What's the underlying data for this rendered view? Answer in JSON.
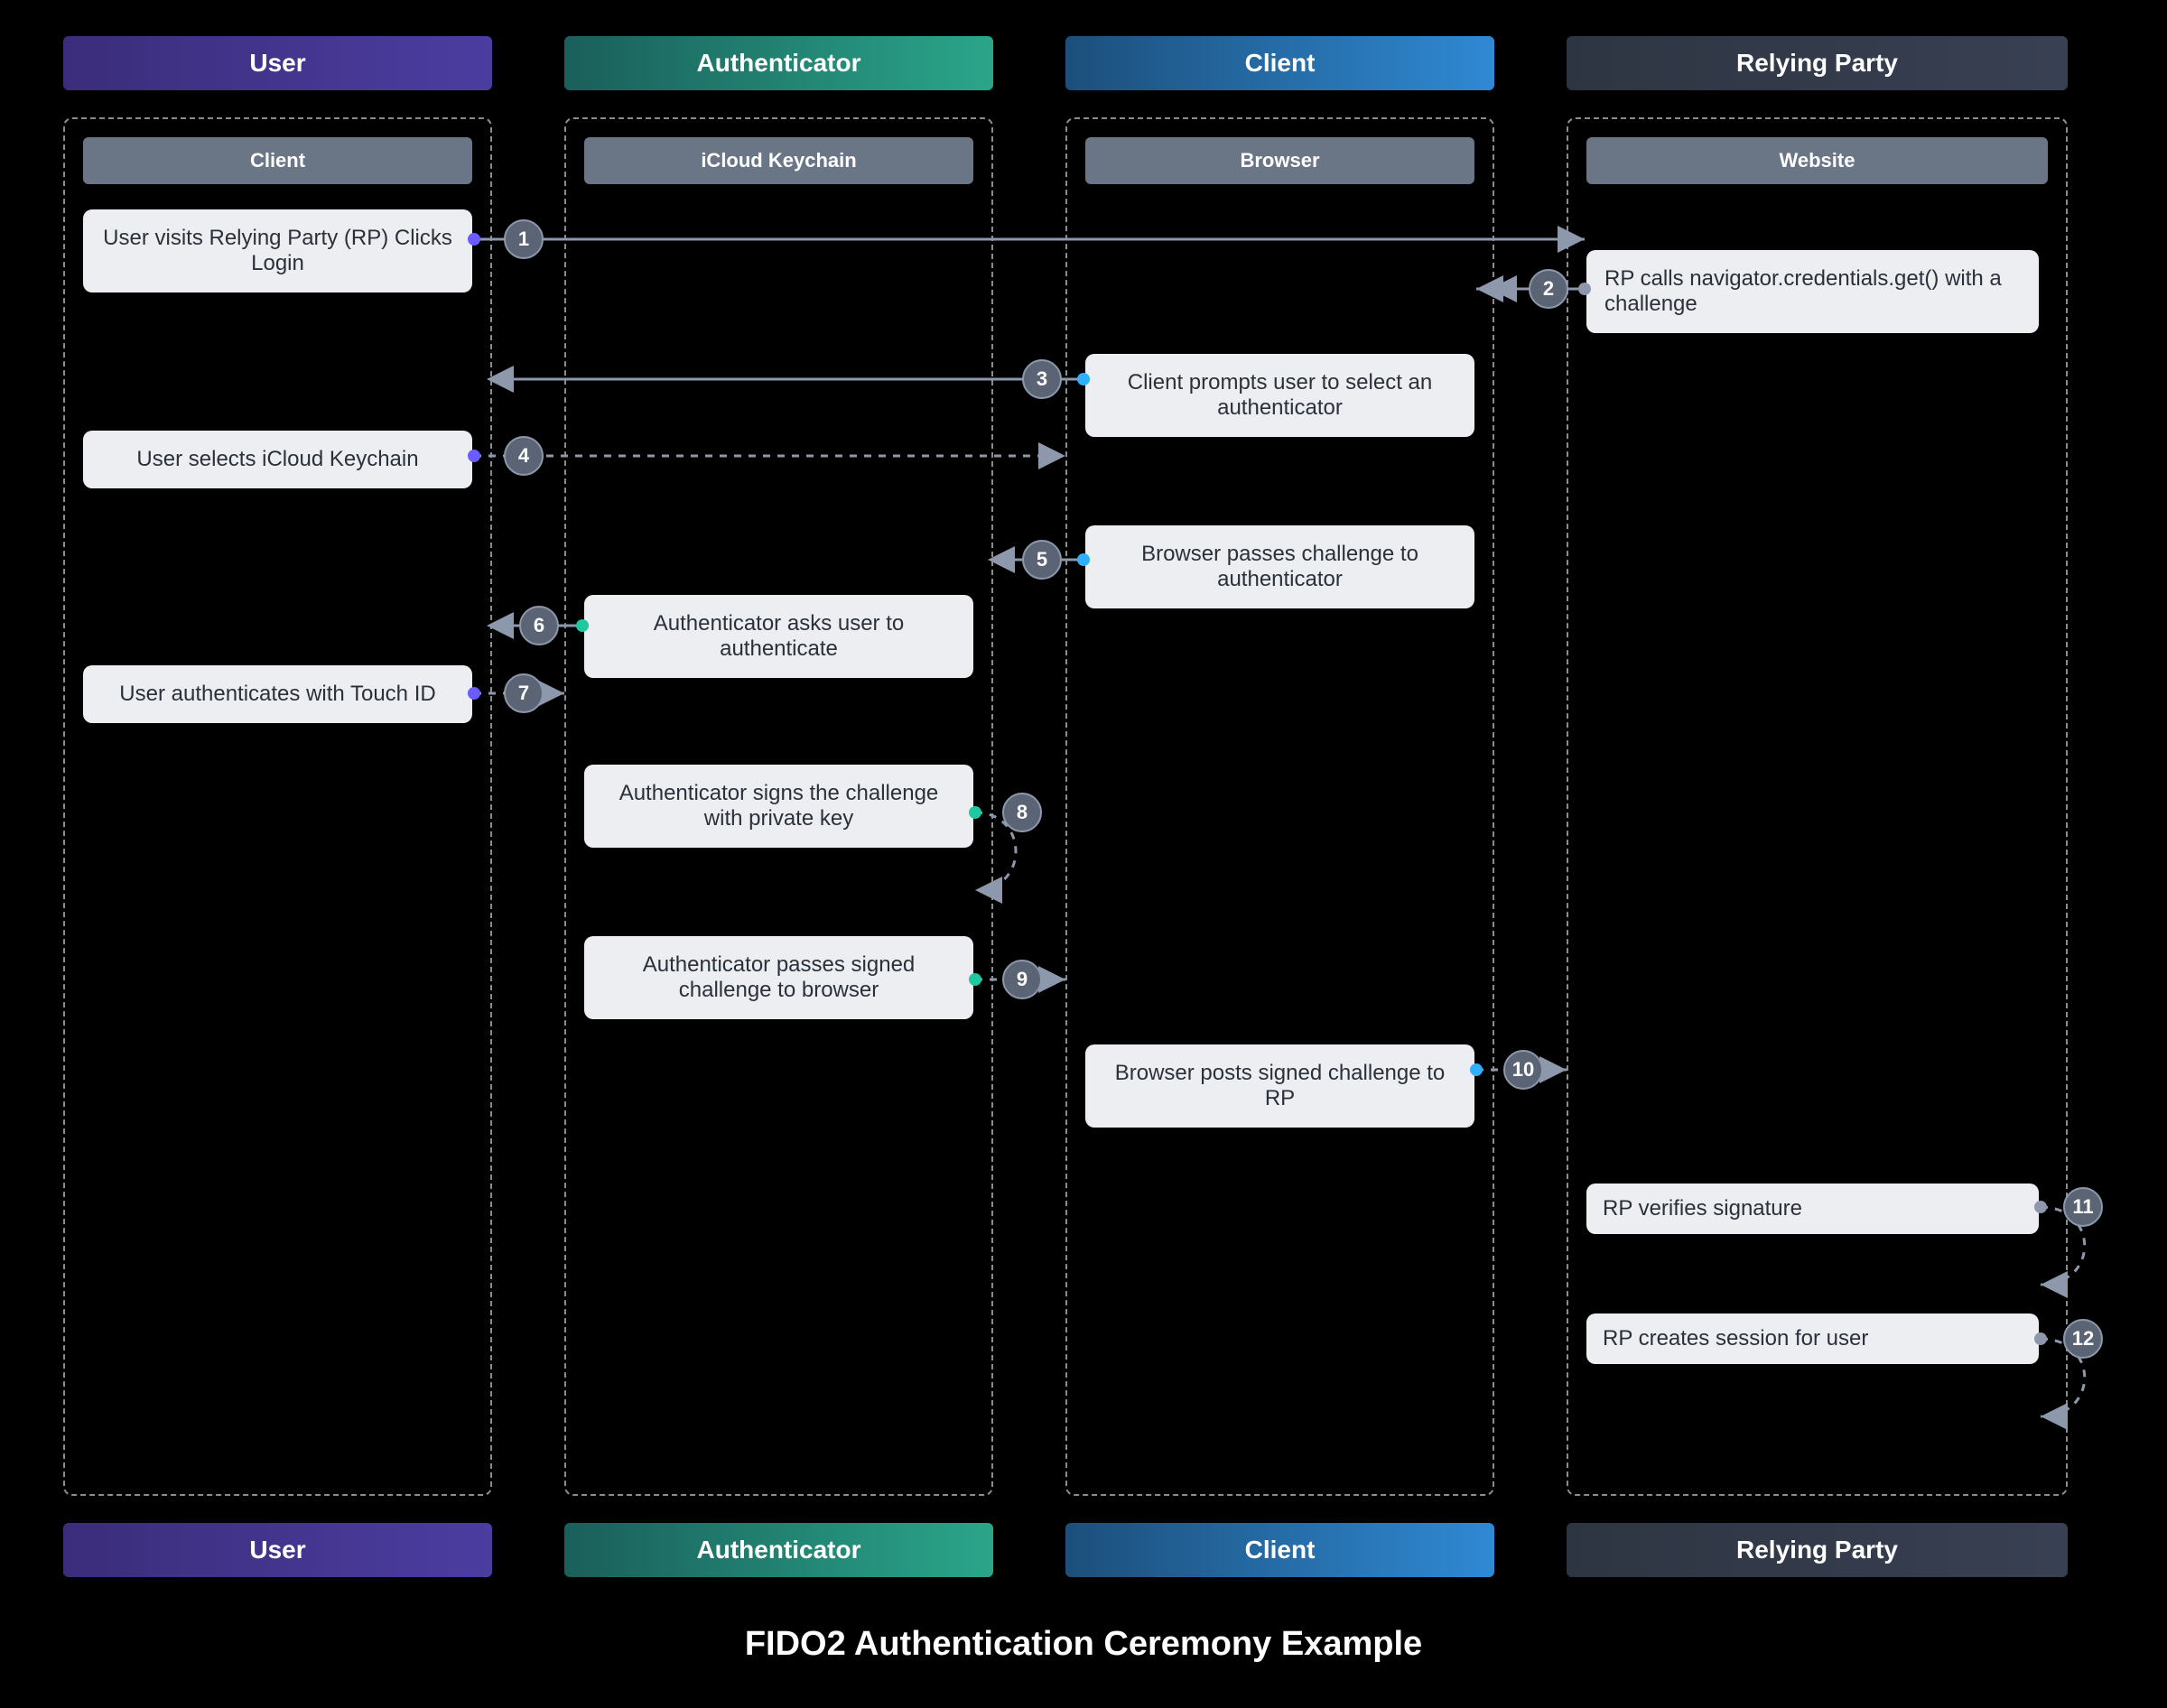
{
  "title": "FIDO2 Authentication Ceremony Example",
  "columns": {
    "user": {
      "header": "User",
      "sub": "Client",
      "footer": "User"
    },
    "auth": {
      "header": "Authenticator",
      "sub": "iCloud Keychain",
      "footer": "Authenticator"
    },
    "client": {
      "header": "Client",
      "sub": "Browser",
      "footer": "Client"
    },
    "rp": {
      "header": "Relying Party",
      "sub": "Website",
      "footer": "Relying Party"
    }
  },
  "steps": {
    "s1": "User visits Relying Party (RP) Clicks Login",
    "s2": "RP calls navigator.credentials.get() with a challenge",
    "s3": "Client prompts user to select an authenticator",
    "s4": "User selects iCloud Keychain",
    "s5": "Browser passes challenge to authenticator",
    "s6": "Authenticator asks user to authenticate",
    "s7": "User authenticates with Touch ID",
    "s8": "Authenticator signs the challenge with private key",
    "s9": "Authenticator passes signed challenge to browser",
    "s10": "Browser posts signed challenge to RP",
    "s11": "RP verifies signature",
    "s12": "RP creates session for user"
  },
  "pills": {
    "p1": "1",
    "p2": "2",
    "p3": "3",
    "p4": "4",
    "p5": "5",
    "p6": "6",
    "p7": "7",
    "p8": "8",
    "p9": "9",
    "p10": "10",
    "p11": "11",
    "p12": "12"
  }
}
